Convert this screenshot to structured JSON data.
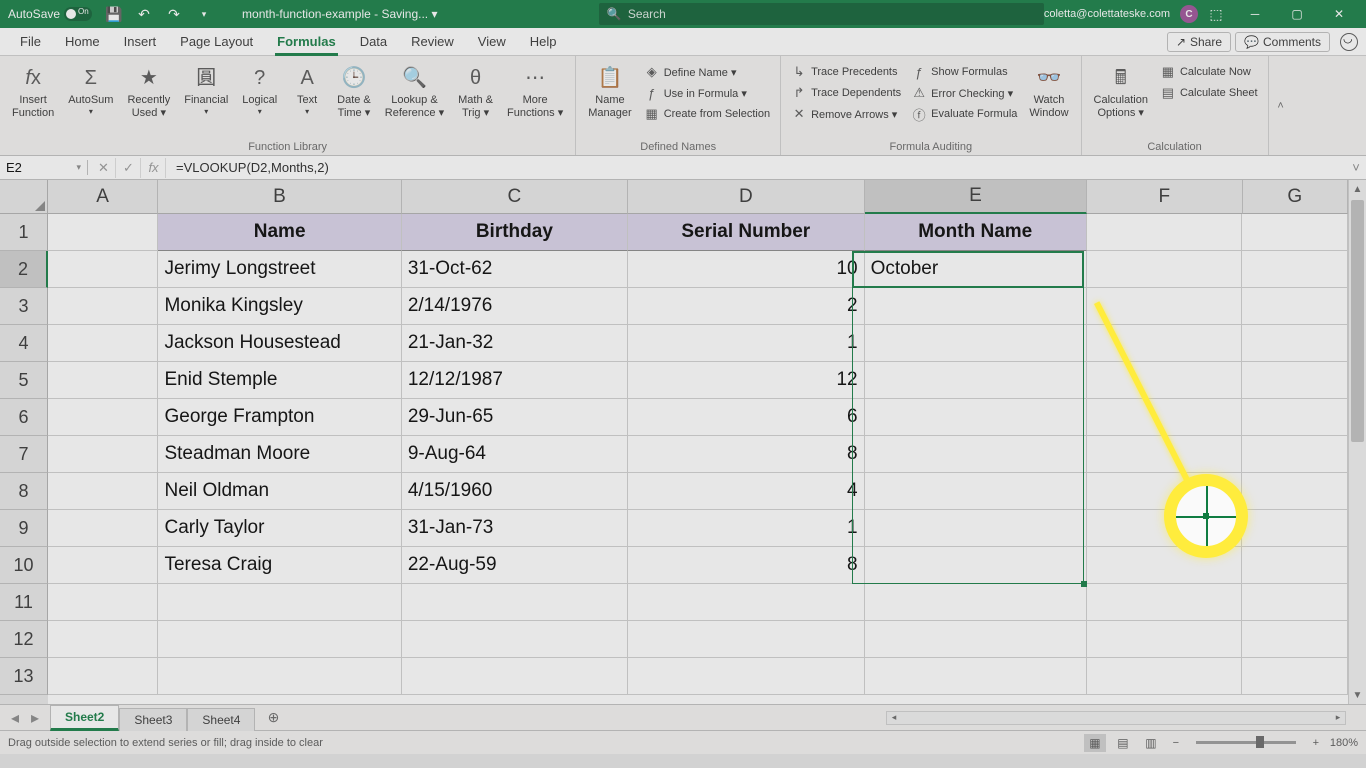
{
  "titlebar": {
    "autosave_label": "AutoSave",
    "autosave_state": "On",
    "filename": "month-function-example - Saving... ▾",
    "search_placeholder": "Search",
    "user_email": "coletta@colettateske.com",
    "user_initial": "C"
  },
  "menu": {
    "tabs": [
      "File",
      "Home",
      "Insert",
      "Page Layout",
      "Formulas",
      "Data",
      "Review",
      "View",
      "Help"
    ],
    "active": "Formulas",
    "share": "Share",
    "comments": "Comments"
  },
  "ribbon": {
    "group1_label": "Function Library",
    "g1": {
      "insert_function": "Insert\nFunction",
      "autosum": "AutoSum",
      "recently_used": "Recently\nUsed ▾",
      "financial": "Financial",
      "logical": "Logical",
      "text": "Text",
      "date_time": "Date &\nTime ▾",
      "lookup_ref": "Lookup &\nReference ▾",
      "math_trig": "Math &\nTrig ▾",
      "more_functions": "More\nFunctions ▾"
    },
    "group2_label": "Defined Names",
    "g2": {
      "name_manager": "Name\nManager",
      "define_name": "Define Name ▾",
      "use_in_formula": "Use in Formula ▾",
      "create_from_selection": "Create from Selection"
    },
    "group3_label": "Formula Auditing",
    "g3": {
      "trace_precedents": "Trace Precedents",
      "trace_dependents": "Trace Dependents",
      "remove_arrows": "Remove Arrows ▾",
      "show_formulas": "Show Formulas",
      "error_checking": "Error Checking ▾",
      "evaluate_formula": "Evaluate Formula",
      "watch_window": "Watch\nWindow"
    },
    "group4_label": "Calculation",
    "g4": {
      "calc_options": "Calculation\nOptions ▾",
      "calc_now": "Calculate Now",
      "calc_sheet": "Calculate Sheet"
    }
  },
  "formula_bar": {
    "name_box": "E2",
    "formula": "=VLOOKUP(D2,Months,2)"
  },
  "grid": {
    "columns": [
      "A",
      "B",
      "C",
      "D",
      "E",
      "F",
      "G"
    ],
    "row_numbers": [
      "1",
      "2",
      "3",
      "4",
      "5",
      "6",
      "7",
      "8",
      "9",
      "10",
      "11",
      "12",
      "13"
    ],
    "headers": {
      "B": "Name",
      "C": "Birthday",
      "D": "Serial Number",
      "E": "Month Name"
    },
    "rows": [
      {
        "B": "Jerimy Longstreet",
        "C": "31-Oct-62",
        "D": "10",
        "E": "October"
      },
      {
        "B": "Monika Kingsley",
        "C": "2/14/1976",
        "D": "2",
        "E": ""
      },
      {
        "B": "Jackson Housestead",
        "C": "21-Jan-32",
        "D": "1",
        "E": ""
      },
      {
        "B": "Enid Stemple",
        "C": "12/12/1987",
        "D": "12",
        "E": ""
      },
      {
        "B": "George Frampton",
        "C": "29-Jun-65",
        "D": "6",
        "E": ""
      },
      {
        "B": "Steadman Moore",
        "C": "9-Aug-64",
        "D": "8",
        "E": ""
      },
      {
        "B": "Neil Oldman",
        "C": "4/15/1960",
        "D": "4",
        "E": ""
      },
      {
        "B": "Carly Taylor",
        "C": "31-Jan-73",
        "D": "1",
        "E": ""
      },
      {
        "B": "Teresa Craig",
        "C": "22-Aug-59",
        "D": "8",
        "E": ""
      }
    ]
  },
  "sheets": {
    "tabs": [
      "Sheet2",
      "Sheet3",
      "Sheet4"
    ],
    "active": "Sheet2"
  },
  "status": {
    "message": "Drag outside selection to extend series or fill; drag inside to clear",
    "zoom": "180%"
  }
}
